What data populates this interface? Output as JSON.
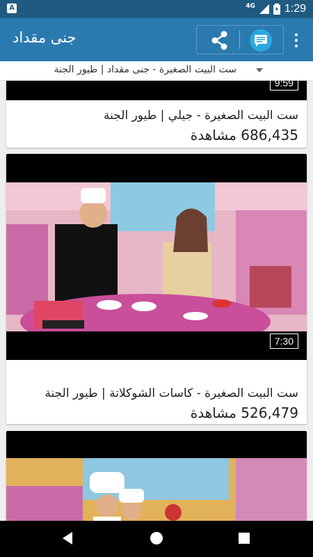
{
  "status_bar": {
    "notification_icon": "A",
    "network": "4G",
    "time": "1:29"
  },
  "app_bar": {
    "title": "جنى مقداد",
    "share_icon": "share-icon",
    "message_icon": "message-icon",
    "more_icon": "more-vert-icon"
  },
  "spinner": {
    "selected": "ست البيت الصغيرة - جنى مقداد | طيور الجنة"
  },
  "videos": [
    {
      "title": "ست البيت الصغيرة - جيلي | طيور الجنة",
      "views": "686,435 مشاهدة",
      "duration": "9:59"
    },
    {
      "title": "ست البيت الصغيرة - كاسات الشوكلاتة | طيور الجنة",
      "views": "526,479 مشاهدة",
      "duration": "7:30"
    },
    {
      "title": "",
      "views": "",
      "duration": ""
    }
  ],
  "nav": {
    "back_icon": "back-icon",
    "home_icon": "home-icon",
    "recent_icon": "recents-icon"
  },
  "colors": {
    "status_bar": "#1f5b80",
    "app_bar": "#2a7ab0",
    "accent": "#2aa9e0"
  }
}
